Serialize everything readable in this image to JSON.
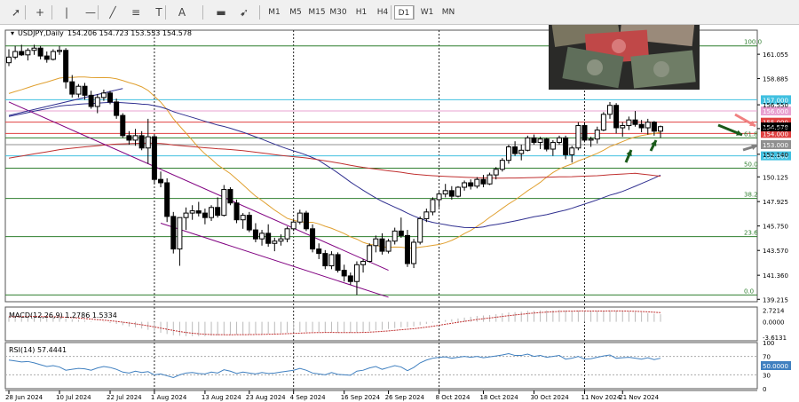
{
  "toolbar": {
    "tools": [
      {
        "name": "cursor-icon",
        "glyph": "➚"
      },
      {
        "name": "crosshair-icon",
        "glyph": "+"
      },
      {
        "name": "vertical-line-icon",
        "glyph": "|"
      },
      {
        "name": "horizontal-line-icon",
        "glyph": "—"
      },
      {
        "name": "trendline-icon",
        "glyph": "╱"
      },
      {
        "name": "fibonacci-icon",
        "glyph": "≡"
      },
      {
        "name": "text-icon",
        "glyph": "T"
      },
      {
        "name": "text-label-icon",
        "glyph": "A"
      },
      {
        "name": "rectangle-label-icon",
        "glyph": "▬"
      },
      {
        "name": "arrows-icon",
        "glyph": "➹"
      }
    ],
    "timeframes": [
      "M1",
      "M5",
      "M15",
      "M30",
      "H1",
      "H4",
      "D1",
      "W1",
      "MN"
    ],
    "active_timeframe": "D1"
  },
  "chart_data": {
    "type": "candlestick",
    "title": "USDJPY,Daily",
    "ohlc_header": "154.206 154.723 153.553 154.578",
    "ylim": [
      139.0,
      163.2
    ],
    "y_ticks": [
      "161.055",
      "158.885",
      "156.550",
      "154.430",
      "152.140",
      "150.125",
      "147.925",
      "145.750",
      "143.570",
      "141.360",
      "139.215"
    ],
    "x_ticks": [
      "28 Jun 2024",
      "10 Jul 2024",
      "22 Jul 2024",
      "1 Aug 2024",
      "13 Aug 2024",
      "23 Aug 2024",
      "4 Sep 2024",
      "16 Sep 2024",
      "26 Sep 2024",
      "8 Oct 2024",
      "18 Oct 2024",
      "30 Oct 2024",
      "11 Nov 2024",
      "21 Nov 2024"
    ],
    "candles": [
      [
        160.3,
        161.5,
        160.0,
        160.8
      ],
      [
        160.8,
        161.8,
        160.6,
        161.3
      ],
      [
        161.3,
        161.9,
        160.9,
        161.0
      ],
      [
        161.0,
        161.6,
        160.5,
        161.4
      ],
      [
        161.4,
        161.9,
        161.0,
        161.6
      ],
      [
        161.6,
        161.8,
        160.6,
        160.9
      ],
      [
        160.9,
        161.3,
        160.3,
        160.6
      ],
      [
        160.6,
        161.5,
        160.5,
        161.3
      ],
      [
        161.3,
        161.8,
        161.0,
        161.4
      ],
      [
        161.4,
        161.6,
        158.0,
        158.6
      ],
      [
        158.6,
        159.2,
        157.2,
        157.5
      ],
      [
        157.5,
        158.4,
        157.2,
        158.2
      ],
      [
        158.2,
        158.5,
        157.0,
        157.4
      ],
      [
        157.4,
        157.8,
        156.2,
        156.4
      ],
      [
        156.4,
        157.5,
        155.8,
        157.2
      ],
      [
        157.2,
        157.9,
        156.9,
        157.6
      ],
      [
        157.6,
        157.8,
        156.6,
        156.8
      ],
      [
        156.8,
        157.1,
        155.3,
        155.6
      ],
      [
        155.6,
        155.8,
        153.6,
        153.8
      ],
      [
        153.8,
        154.2,
        153.0,
        153.4
      ],
      [
        153.4,
        154.4,
        152.9,
        153.8
      ],
      [
        153.8,
        154.2,
        152.5,
        152.7
      ],
      [
        152.7,
        155.3,
        151.3,
        153.7
      ],
      [
        153.7,
        153.9,
        149.5,
        149.9
      ],
      [
        149.9,
        150.6,
        149.2,
        149.6
      ],
      [
        149.6,
        150.0,
        146.1,
        146.6
      ],
      [
        146.6,
        147.0,
        143.3,
        143.7
      ],
      [
        143.7,
        144.8,
        142.2,
        146.5
      ],
      [
        146.5,
        147.4,
        145.4,
        146.9
      ],
      [
        146.9,
        147.6,
        146.3,
        147.1
      ],
      [
        147.1,
        147.9,
        146.6,
        146.9
      ],
      [
        146.9,
        147.3,
        145.9,
        146.5
      ],
      [
        146.5,
        147.6,
        146.2,
        147.4
      ],
      [
        147.4,
        148.3,
        146.5,
        146.7
      ],
      [
        146.7,
        149.4,
        146.6,
        149.0
      ],
      [
        149.0,
        149.2,
        147.6,
        147.8
      ],
      [
        147.8,
        148.1,
        146.0,
        146.3
      ],
      [
        146.3,
        146.9,
        145.5,
        146.7
      ],
      [
        146.7,
        147.0,
        145.2,
        145.4
      ],
      [
        145.4,
        146.0,
        144.3,
        144.6
      ],
      [
        144.6,
        145.4,
        144.0,
        145.1
      ],
      [
        145.1,
        145.9,
        143.9,
        144.2
      ],
      [
        144.2,
        144.7,
        143.5,
        144.4
      ],
      [
        144.4,
        145.0,
        144.0,
        144.6
      ],
      [
        144.6,
        145.7,
        144.3,
        145.5
      ],
      [
        145.5,
        146.3,
        145.3,
        146.1
      ],
      [
        146.1,
        147.2,
        145.9,
        146.9
      ],
      [
        146.9,
        147.1,
        145.3,
        145.5
      ],
      [
        145.5,
        145.9,
        143.4,
        143.7
      ],
      [
        143.7,
        144.2,
        142.8,
        143.3
      ],
      [
        143.3,
        143.6,
        141.9,
        142.2
      ],
      [
        142.2,
        143.5,
        141.9,
        143.2
      ],
      [
        143.2,
        143.4,
        141.6,
        141.8
      ],
      [
        141.8,
        142.3,
        140.8,
        141.3
      ],
      [
        141.3,
        141.6,
        140.5,
        140.8
      ],
      [
        140.8,
        142.6,
        139.6,
        142.3
      ],
      [
        142.3,
        142.8,
        141.6,
        142.6
      ],
      [
        142.6,
        144.2,
        142.5,
        144.0
      ],
      [
        144.0,
        144.9,
        143.4,
        144.6
      ],
      [
        144.6,
        145.1,
        143.2,
        143.5
      ],
      [
        143.5,
        144.6,
        143.3,
        144.4
      ],
      [
        144.4,
        145.6,
        144.1,
        145.3
      ],
      [
        145.3,
        146.5,
        144.7,
        144.9
      ],
      [
        144.9,
        145.4,
        142.1,
        142.4
      ],
      [
        142.4,
        144.6,
        142.0,
        144.3
      ],
      [
        144.3,
        146.6,
        144.1,
        146.4
      ],
      [
        146.4,
        147.3,
        146.1,
        147.0
      ],
      [
        147.0,
        148.3,
        146.7,
        148.1
      ],
      [
        148.1,
        148.8,
        147.4,
        148.6
      ],
      [
        148.6,
        149.5,
        148.3,
        148.9
      ],
      [
        148.9,
        149.3,
        148.1,
        148.4
      ],
      [
        148.4,
        149.3,
        148.3,
        149.2
      ],
      [
        149.2,
        149.8,
        148.9,
        149.6
      ],
      [
        149.6,
        149.9,
        149.0,
        149.3
      ],
      [
        149.3,
        150.1,
        149.1,
        149.9
      ],
      [
        149.9,
        150.3,
        149.2,
        149.5
      ],
      [
        149.5,
        150.5,
        149.4,
        150.3
      ],
      [
        150.3,
        151.0,
        149.9,
        150.8
      ],
      [
        150.8,
        151.8,
        150.6,
        151.6
      ],
      [
        151.6,
        153.0,
        151.3,
        152.8
      ],
      [
        152.8,
        153.3,
        152.0,
        152.2
      ],
      [
        152.2,
        153.0,
        151.6,
        152.5
      ],
      [
        152.5,
        153.8,
        152.4,
        153.6
      ],
      [
        153.6,
        153.9,
        153.0,
        153.2
      ],
      [
        153.2,
        153.7,
        152.6,
        153.5
      ],
      [
        153.5,
        153.6,
        152.4,
        152.6
      ],
      [
        152.6,
        153.4,
        152.0,
        153.2
      ],
      [
        153.2,
        153.8,
        153.0,
        153.6
      ],
      [
        153.6,
        153.8,
        151.7,
        152.1
      ],
      [
        152.1,
        152.9,
        151.4,
        152.7
      ],
      [
        152.7,
        155.0,
        152.5,
        154.7
      ],
      [
        154.7,
        155.0,
        153.2,
        153.4
      ],
      [
        153.4,
        153.7,
        152.8,
        153.5
      ],
      [
        153.5,
        154.6,
        153.1,
        154.3
      ],
      [
        154.3,
        155.9,
        154.2,
        155.7
      ],
      [
        155.7,
        156.8,
        155.3,
        156.5
      ],
      [
        156.5,
        156.7,
        154.0,
        154.5
      ],
      [
        154.5,
        155.0,
        153.7,
        154.7
      ],
      [
        154.7,
        155.5,
        154.3,
        155.2
      ],
      [
        155.2,
        156.0,
        154.6,
        154.8
      ],
      [
        154.8,
        155.2,
        154.1,
        154.5
      ],
      [
        154.5,
        155.3,
        153.9,
        155.0
      ],
      [
        155.0,
        155.1,
        153.8,
        154.2
      ],
      [
        154.2,
        154.7,
        153.6,
        154.6
      ]
    ],
    "levels": [
      {
        "price": 157.0,
        "color": "#40c0e0",
        "label": "157.000"
      },
      {
        "price": 156.0,
        "color": "#e8a0d0",
        "label": "156.000"
      },
      {
        "price": 155.0,
        "color": "#e04040",
        "label": "155.000"
      },
      {
        "price": 154.0,
        "color": "#e04040",
        "label": "154.000"
      },
      {
        "price": 153.0,
        "color": "#909090",
        "label": "153.000"
      },
      {
        "price": 152.0,
        "color": "#40c0e0",
        "label": "152.000"
      }
    ],
    "price_marker": {
      "price": 154.578,
      "label": "154.578",
      "color": "#000000"
    },
    "fib": [
      {
        "price": 161.8,
        "label": "100.0"
      },
      {
        "price": 153.6,
        "label": "61.8"
      },
      {
        "price": 150.9,
        "label": "50.0"
      },
      {
        "price": 148.2,
        "label": "38.2"
      },
      {
        "price": 144.8,
        "label": "23.6"
      },
      {
        "price": 139.6,
        "label": "0.0"
      }
    ],
    "macd": {
      "label": "MACD(12,26,9) 1.2786 1.5334",
      "ticks": [
        "2.7214",
        "0.0000",
        "-3.6131"
      ],
      "ylim": [
        -4.5,
        3.5
      ],
      "values": [
        1.2,
        1.3,
        1.3,
        1.3,
        1.3,
        1.2,
        1.1,
        1.1,
        1.0,
        0.8,
        0.6,
        0.5,
        0.3,
        0.1,
        0.0,
        -0.1,
        -0.3,
        -0.5,
        -0.8,
        -1.1,
        -1.3,
        -1.6,
        -1.9,
        -2.3,
        -2.6,
        -2.9,
        -3.2,
        -3.3,
        -3.4,
        -3.4,
        -3.4,
        -3.4,
        -3.3,
        -3.2,
        -3.1,
        -3.1,
        -3.0,
        -3.0,
        -3.0,
        -2.9,
        -2.9,
        -2.8,
        -2.8,
        -2.7,
        -2.6,
        -2.5,
        -2.4,
        -2.4,
        -2.4,
        -2.4,
        -2.5,
        -2.5,
        -2.6,
        -2.6,
        -2.6,
        -2.5,
        -2.4,
        -2.2,
        -2.0,
        -1.9,
        -1.7,
        -1.5,
        -1.3,
        -1.3,
        -1.1,
        -0.8,
        -0.5,
        -0.2,
        0.1,
        0.4,
        0.6,
        0.8,
        1.0,
        1.2,
        1.4,
        1.5,
        1.6,
        1.8,
        2.0,
        2.2,
        2.3,
        2.4,
        2.6,
        2.6,
        2.7,
        2.7,
        2.7,
        2.8,
        2.7,
        2.6,
        2.7,
        2.6,
        2.5,
        2.5,
        2.6,
        2.7,
        2.6,
        2.5,
        2.4,
        2.3,
        2.2,
        2.1,
        1.9,
        1.8
      ]
    },
    "rsi": {
      "label": "RSI(14) 57.4441",
      "ticks": [
        "100",
        "70",
        "50.0000",
        "30",
        "0"
      ],
      "values": [
        62,
        60,
        58,
        59,
        56,
        52,
        48,
        50,
        47,
        40,
        42,
        44,
        43,
        40,
        45,
        48,
        46,
        42,
        36,
        34,
        38,
        35,
        37,
        30,
        32,
        28,
        24,
        30,
        34,
        35,
        33,
        32,
        36,
        34,
        41,
        38,
        33,
        36,
        34,
        32,
        35,
        33,
        34,
        36,
        38,
        40,
        44,
        40,
        34,
        32,
        30,
        35,
        31,
        30,
        29,
        38,
        40,
        45,
        48,
        42,
        46,
        50,
        47,
        39,
        46,
        56,
        62,
        66,
        68,
        69,
        66,
        68,
        70,
        68,
        70,
        67,
        69,
        71,
        73,
        76,
        72,
        72,
        75,
        70,
        72,
        68,
        70,
        72,
        64,
        66,
        70,
        64,
        65,
        68,
        71,
        73,
        66,
        67,
        68,
        66,
        64,
        67,
        63,
        66
      ]
    }
  }
}
